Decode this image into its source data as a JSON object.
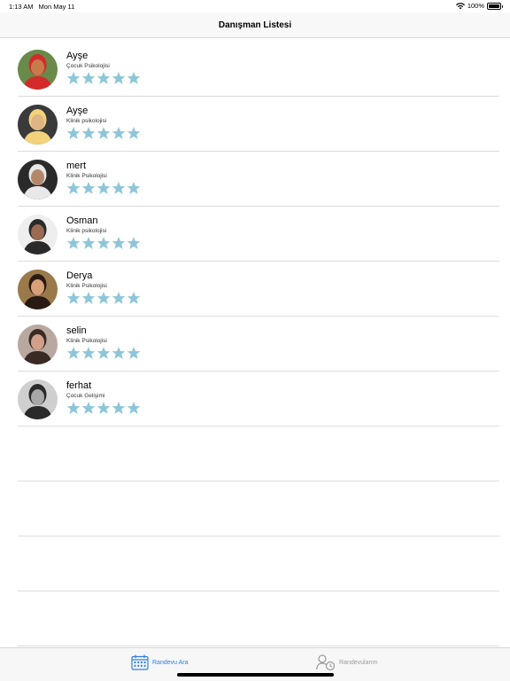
{
  "status_bar": {
    "time": "1:13 AM",
    "date": "Mon May 11",
    "battery_label": "100%"
  },
  "nav": {
    "title": "Danışman Listesi"
  },
  "counselors": [
    {
      "name": "Ayşe",
      "specialty": "Çocuk Psikolojisi",
      "rating": 5,
      "avatar_colors": [
        "#c87b4a",
        "#d42a2a",
        "#6a8a4a"
      ]
    },
    {
      "name": "Ayşe",
      "specialty": "Klinik psikolojisi",
      "rating": 5,
      "avatar_colors": [
        "#e0b484",
        "#f2d27a",
        "#3a3a3a"
      ]
    },
    {
      "name": "mert",
      "specialty": "Klinik Psikolojisi",
      "rating": 5,
      "avatar_colors": [
        "#b5876a",
        "#e8e8e8",
        "#2a2a2a"
      ]
    },
    {
      "name": "Osman",
      "specialty": "Klinik psikolojisi",
      "rating": 5,
      "avatar_colors": [
        "#9a6b52",
        "#2a2a2a",
        "#eeeeee"
      ]
    },
    {
      "name": "Derya",
      "specialty": "Klinik Psikolojisi",
      "rating": 5,
      "avatar_colors": [
        "#d8a078",
        "#2a1a14",
        "#9a7a4a"
      ]
    },
    {
      "name": "selin",
      "specialty": "Klinik Psikolojisi",
      "rating": 5,
      "avatar_colors": [
        "#d0a08a",
        "#3a2a24",
        "#b8a8a0"
      ]
    },
    {
      "name": "ferhat",
      "specialty": "Çocuk Gelişimi",
      "rating": 5,
      "avatar_colors": [
        "#a8a8a8",
        "#2a2a2a",
        "#cfcfcf"
      ]
    }
  ],
  "empty_rows": 4,
  "star_color": "#8ec6d9",
  "tabs": [
    {
      "label": "Randevu Ara",
      "icon": "calendar-icon",
      "active": true,
      "color": "#2d7ee8"
    },
    {
      "label": "Randevularım",
      "icon": "user-clock-icon",
      "active": false,
      "color": "#9a9a9a"
    }
  ]
}
